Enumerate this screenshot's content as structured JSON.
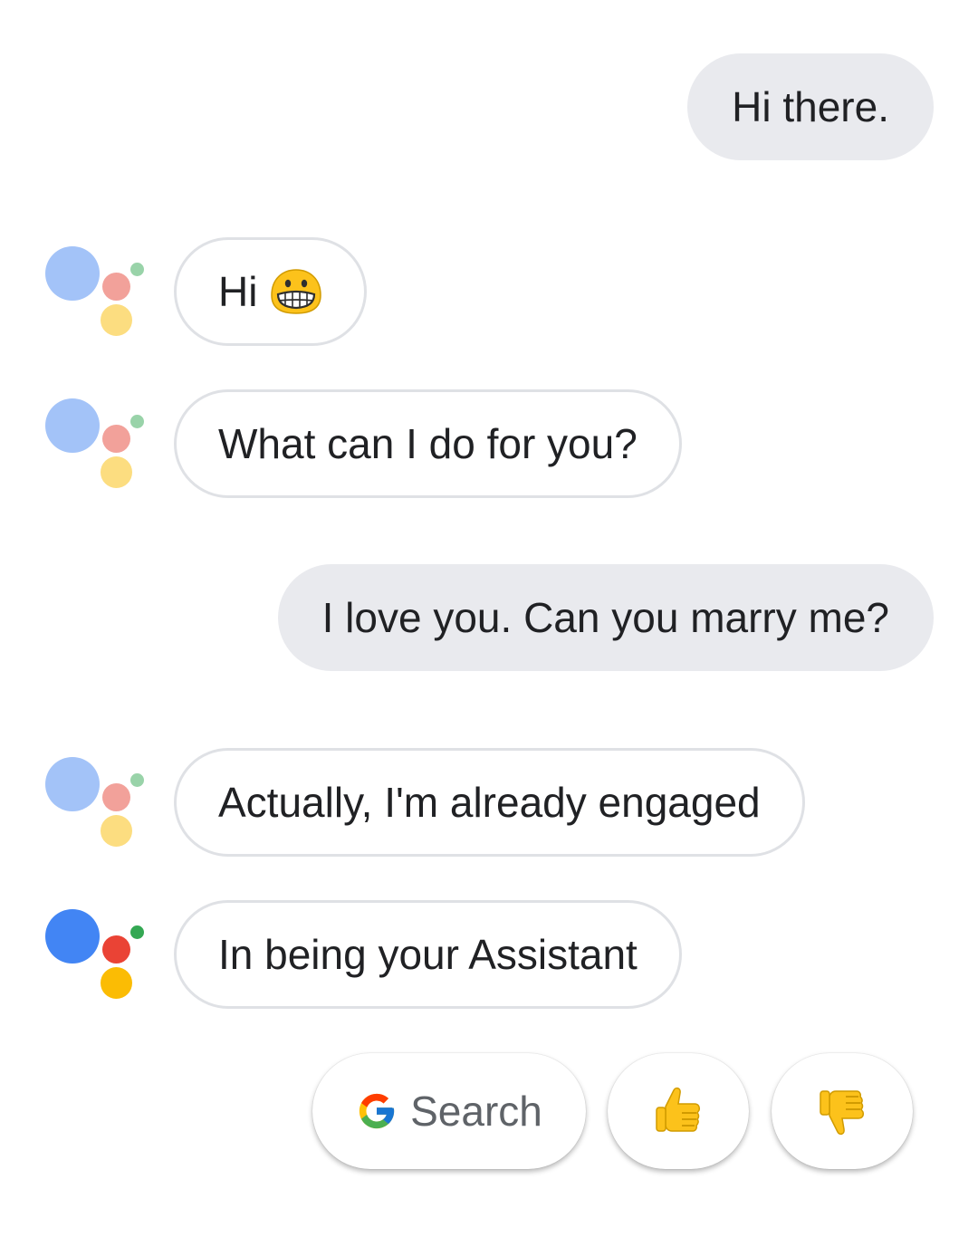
{
  "messages": [
    {
      "sender": "user",
      "text": "Hi there."
    },
    {
      "sender": "assistant",
      "text": "Hi",
      "emoji": "grinning-face-icon"
    },
    {
      "sender": "assistant",
      "text": "What can I do for you?"
    },
    {
      "sender": "user",
      "text": "I love you. Can you marry me?"
    },
    {
      "sender": "assistant",
      "text": "Actually, I'm already engaged"
    },
    {
      "sender": "assistant",
      "text": "In being your Assistant"
    }
  ],
  "suggestion_chips": {
    "search_label": "Search",
    "search_icon": "google-g-icon",
    "thumbs_up_icon": "thumbs-up-icon",
    "thumbs_down_icon": "thumbs-down-icon"
  },
  "colors": {
    "user_bubble_bg": "#e9eaee",
    "assistant_bubble_border": "#dfe1e5",
    "logo_blue": "#4285f4",
    "logo_red": "#ea4335",
    "logo_yellow": "#fbbc04",
    "logo_green": "#34a853",
    "logo_blue_faded": "#a3c3f8",
    "logo_red_faded": "#f2a19a",
    "logo_yellow_faded": "#fcdd80",
    "logo_green_faded": "#99d3a9"
  }
}
